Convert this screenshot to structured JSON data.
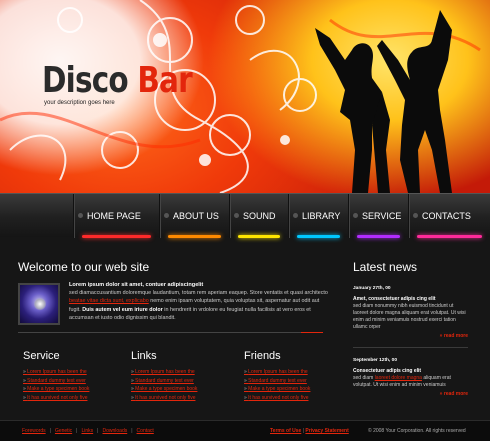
{
  "header": {
    "logo_part1": "Disco ",
    "logo_part2": "Bar",
    "tagline": "your description goes here"
  },
  "nav": {
    "items": [
      {
        "label": "HOME PAGE",
        "glow": "#ff2a2a"
      },
      {
        "label": "ABOUT US",
        "glow": "#ff8a00"
      },
      {
        "label": "SOUND",
        "glow": "#ffe600"
      },
      {
        "label": "LIBRARY",
        "glow": "#00c8ff"
      },
      {
        "label": "SERVICE",
        "glow": "#b22cff"
      },
      {
        "label": "CONTACTS",
        "glow": "#ff2a9a"
      }
    ]
  },
  "welcome": {
    "title": "Welcome to our web site",
    "lead": "Lorem ipsum dolor sit amet, contuer adipiscingelit",
    "text1": "sed diamaccusantium doloremque laudantium, totam rem aperiam eaquep. Store ventatis et quasi architecto",
    "link": "beatae vitae dicta sunt, explicabo",
    "text2": "nemo enim ipsam voluptatem, quia voluptas sit, aspernatur aut odit aut fugit.",
    "bold": "Duis autem vel eum iriure dolor",
    "text3": "in hendrerit in vrdolore eu feugiat nulla facilisis at vero eros et accumsan et iusto odio dignissim qui blandit."
  },
  "columns": [
    {
      "title": "Service",
      "links": [
        "Lorem Ipsum has been the",
        "Standard dummy text ever",
        "Make a type specimen book",
        "It has survived not only five"
      ]
    },
    {
      "title": "Links",
      "links": [
        "Lorem Ipsum has been the",
        "Standard dummy text ever",
        "Make a type specimen book",
        "It has survived not only five"
      ]
    },
    {
      "title": "Friends",
      "links": [
        "Lorem Ipsum has been the",
        "Standard dummy text ever",
        "Make a type specimen book",
        "It has survived not only five"
      ]
    }
  ],
  "news": {
    "title": "Latest news",
    "items": [
      {
        "date": "January 27th, 00",
        "title": "Amet, consectetuer adipis cing elit",
        "text": "sed diam nonummy nibh euismod tincidunt ut laoreet dolore magna aliquam erat volutpat. Ut wisi enim ad minim veniamuis nostrud exerci tation ullamc orper",
        "link": "",
        "text_after": "",
        "read_more": "read more"
      },
      {
        "date": "September 12th, 00",
        "title": "Consectetuer adipis cing elit",
        "text": "sed diam",
        "link": "laoreet dolore magna",
        "text_after": "aliquam erat volutpat. Ut wisi enim ad minim veniamuis",
        "read_more": "read more"
      }
    ]
  },
  "footer": {
    "links": [
      "Forewords",
      "Genetic",
      "Links",
      "Downloads",
      "Contact"
    ],
    "separator": "|",
    "terms": "Terms of Use",
    "privacy": "Privacy Statement",
    "copyright": "© 2008 Your Corporation.  All rights reserved"
  }
}
